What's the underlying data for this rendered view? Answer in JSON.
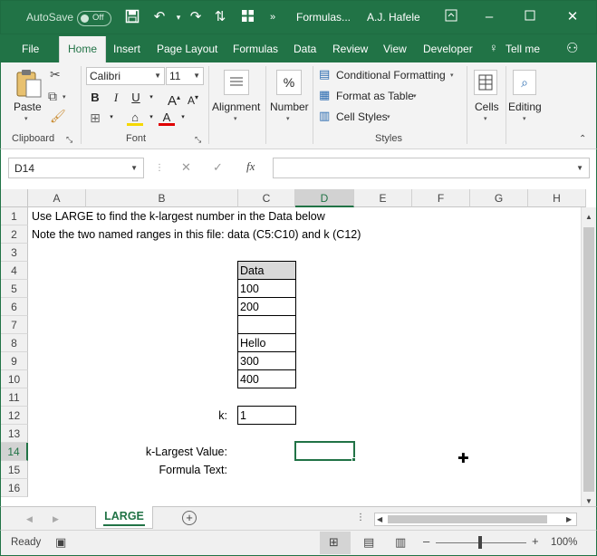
{
  "titlebar": {
    "autosave_label": "AutoSave",
    "autosave_state": "Off",
    "filename": "Formulas...",
    "user": "A.J. Hafele"
  },
  "tabs": [
    "File",
    "Home",
    "Insert",
    "Page Layout",
    "Formulas",
    "Data",
    "Review",
    "View",
    "Developer"
  ],
  "active_tab": "Home",
  "tell_me": "Tell me",
  "ribbon": {
    "clipboard": {
      "paste": "Paste",
      "group": "Clipboard"
    },
    "font": {
      "family": "Calibri",
      "size": "11",
      "bold": "B",
      "italic": "I",
      "underline": "U",
      "group": "Font"
    },
    "alignment": "Alignment",
    "number": {
      "label": "Number",
      "symbol": "%"
    },
    "styles": {
      "conditional": "Conditional Formatting",
      "table": "Format as Table",
      "cell": "Cell Styles",
      "group": "Styles"
    },
    "cells": "Cells",
    "editing": "Editing"
  },
  "formula_bar": {
    "name_box": "D14",
    "fx": "fx",
    "formula": ""
  },
  "columns": [
    "A",
    "B",
    "C",
    "D",
    "E",
    "F",
    "G",
    "H"
  ],
  "rows": [
    "1",
    "2",
    "3",
    "4",
    "5",
    "6",
    "7",
    "8",
    "9",
    "10",
    "11",
    "12",
    "13",
    "14",
    "15",
    "16"
  ],
  "cells": {
    "A1": "Use LARGE to find the k-largest number in the Data below",
    "A2": "Note the two named ranges in this file: data (C5:C10) and k (C12)",
    "C4": "Data",
    "C5": "100",
    "C6": "200",
    "C8": "Hello",
    "C9": "300",
    "C10": "400",
    "B12": "k:",
    "C12": "1",
    "B14": "k-Largest Value:",
    "B15": "Formula Text:"
  },
  "sheet_tab": "LARGE",
  "status": {
    "ready": "Ready",
    "zoom": "100%"
  },
  "colors": {
    "excel_green": "#217346",
    "header_fill": "#d9d9d9"
  }
}
